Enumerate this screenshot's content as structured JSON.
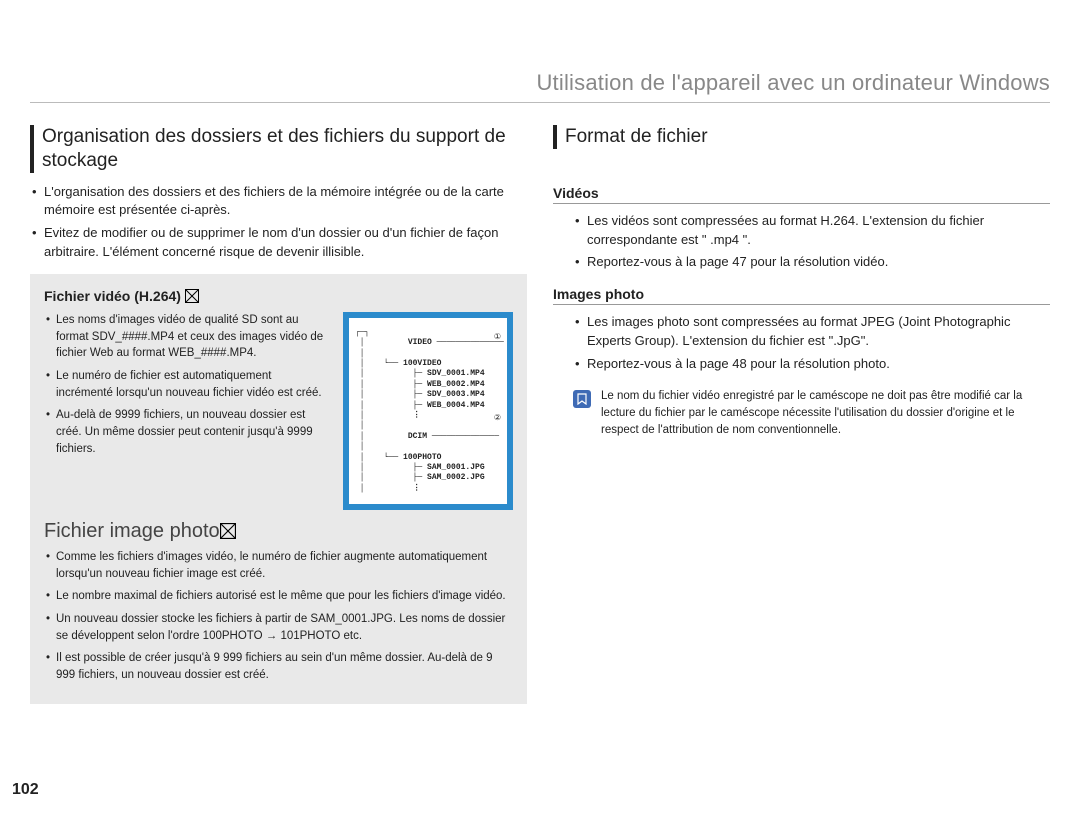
{
  "header": "Utilisation de l'appareil avec un ordinateur Windows",
  "pageNumber": "102",
  "left": {
    "title": "Organisation des dossiers et des fichiers du support de stockage",
    "intro": [
      "L'organisation des dossiers et des fichiers de la mémoire intégrée ou de la carte mémoire est présentée ci-après.",
      "Evitez de modifier ou de supprimer le nom d'un dossier ou d'un fichier de façon arbitraire. L'élément concerné risque de devenir illisible."
    ],
    "video": {
      "heading": "Fichier vidéo (H.264)",
      "items": [
        "Les noms d'images vidéo de qualité SD sont au format SDV_####.MP4 et ceux des images vidéo de fichier Web au format WEB_####.MP4.",
        "Le numéro de fichier est automatiquement incrémenté lorsqu'un nouveau fichier vidéo est créé.",
        "Au-delà de 9999 fichiers, un nouveau dossier est créé. Un même dossier peut contenir jusqu'à 9999 fichiers."
      ]
    },
    "tree": {
      "ref1": "①",
      "ref2": "②",
      "nodes": {
        "video": "VIDEO",
        "videoFolder": "100VIDEO",
        "videoFiles": [
          "SDV_0001.MP4",
          "WEB_0002.MP4",
          "SDV_0003.MP4",
          "WEB_0004.MP4"
        ],
        "dcim": "DCIM",
        "photoFolder": "100PHOTO",
        "photoFiles": [
          "SAM_0001.JPG",
          "SAM_0002.JPG"
        ]
      }
    },
    "photo": {
      "heading": "Fichier image photo",
      "items": [
        "Comme les fichiers d'images vidéo, le numéro de fichier augmente automatiquement lorsqu'un nouveau fichier image est créé.",
        "Le nombre maximal de fichiers autorisé est le même que pour les fichiers d'image vidéo.",
        "Un nouveau dossier stocke les fichiers à partir de SAM_0001.JPG. Les noms de dossier se développent selon l'ordre 100PHOTO → 101PHOTO etc.",
        "Il est possible de créer jusqu'à 9 999 fichiers au sein d'un même dossier. Au-delà de 9 999 fichiers, un nouveau dossier est créé."
      ]
    }
  },
  "right": {
    "title": "Format de fichier",
    "videos": {
      "heading": "Vidéos",
      "items": [
        "Les vidéos sont compressées au format H.264. L'extension du fichier correspondante est \" .mp4 \".",
        "Reportez-vous à la page 47 pour la résolution vidéo."
      ]
    },
    "images": {
      "heading": "Images photo",
      "items": [
        "Les images photo sont compressées au format JPEG (Joint Photographic Experts Group). L'extension du fichier est \".JpG\".",
        "Reportez-vous à la page 48 pour la résolution photo."
      ]
    },
    "note": {
      "iconLabel": "note-icon",
      "text": "Le nom du fichier vidéo enregistré par le caméscope ne doit pas être modifié car la lecture du fichier par le caméscope nécessite l'utilisation du dossier d'origine et le respect de l'attribution de nom conventionnelle."
    }
  }
}
